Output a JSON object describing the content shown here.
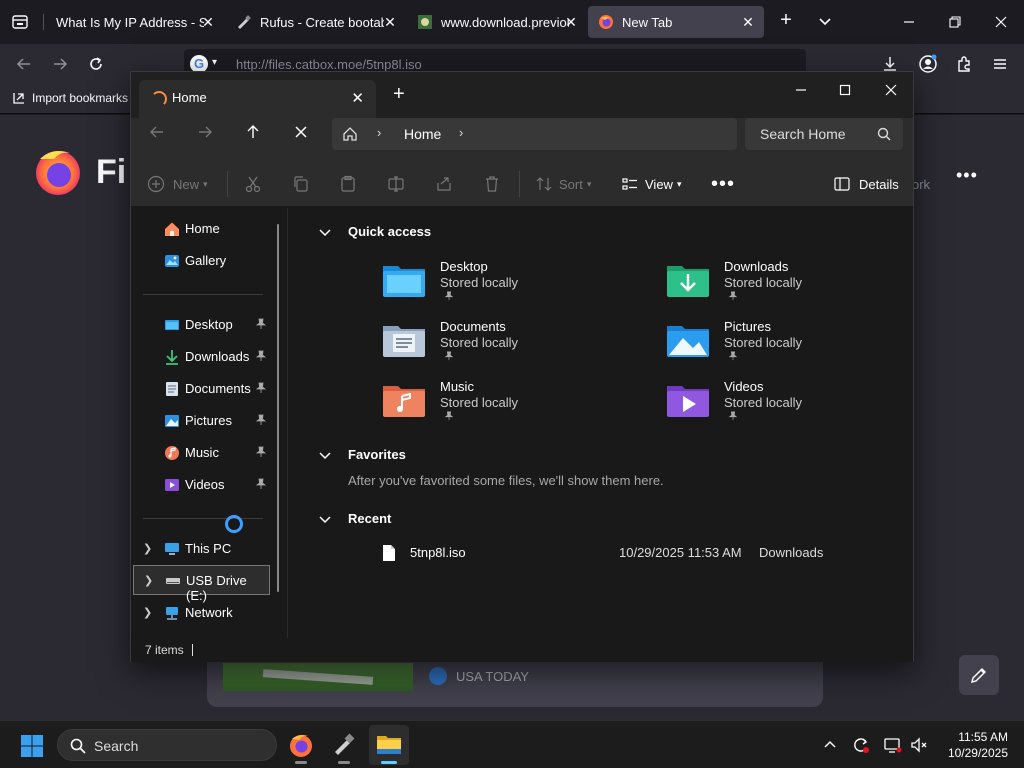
{
  "browser": {
    "tabs": [
      {
        "title": "What Is My IP Address - Se",
        "active": false
      },
      {
        "title": "Rufus - Create bootable",
        "active": false
      },
      {
        "title": "www.download.previou",
        "active": false
      },
      {
        "title": "New Tab",
        "active": true
      }
    ],
    "url": "http://files.catbox.moe/5tnp8l.iso",
    "import_bookmarks": "Import bookmarks",
    "brand_partial": "Fi",
    "work_partial": "ork",
    "news_source": "USA TODAY"
  },
  "explorer": {
    "tab_title": "Home",
    "breadcrumb": "Home",
    "search_placeholder": "Search Home",
    "toolbar": {
      "new_label": "New",
      "sort_label": "Sort",
      "view_label": "View",
      "details_label": "Details"
    },
    "sidebar": {
      "top": [
        {
          "label": "Home"
        },
        {
          "label": "Gallery"
        }
      ],
      "pinned": [
        {
          "label": "Desktop"
        },
        {
          "label": "Downloads"
        },
        {
          "label": "Documents"
        },
        {
          "label": "Pictures"
        },
        {
          "label": "Music"
        },
        {
          "label": "Videos"
        }
      ],
      "drives": [
        {
          "label": "This PC"
        },
        {
          "label": "USB Drive (E:)"
        },
        {
          "label": "Network"
        }
      ]
    },
    "sections": {
      "quick_access": "Quick access",
      "favorites": "Favorites",
      "recent": "Recent"
    },
    "quick_access": [
      {
        "name": "Desktop",
        "sub": "Stored locally"
      },
      {
        "name": "Downloads",
        "sub": "Stored locally"
      },
      {
        "name": "Documents",
        "sub": "Stored locally"
      },
      {
        "name": "Pictures",
        "sub": "Stored locally"
      },
      {
        "name": "Music",
        "sub": "Stored locally"
      },
      {
        "name": "Videos",
        "sub": "Stored locally"
      }
    ],
    "favorites_empty": "After you've favorited some files, we'll show them here.",
    "recent": [
      {
        "name": "5tnp8l.iso",
        "date": "10/29/2025 11:53 AM",
        "location": "Downloads"
      }
    ],
    "status": "7 items"
  },
  "taskbar": {
    "search_label": "Search",
    "time": "11:55 AM",
    "date": "10/29/2025"
  },
  "colors": {
    "accent": "#60cdff",
    "firefox_dark": "#1c1b22",
    "explorer_bg": "#191919"
  }
}
